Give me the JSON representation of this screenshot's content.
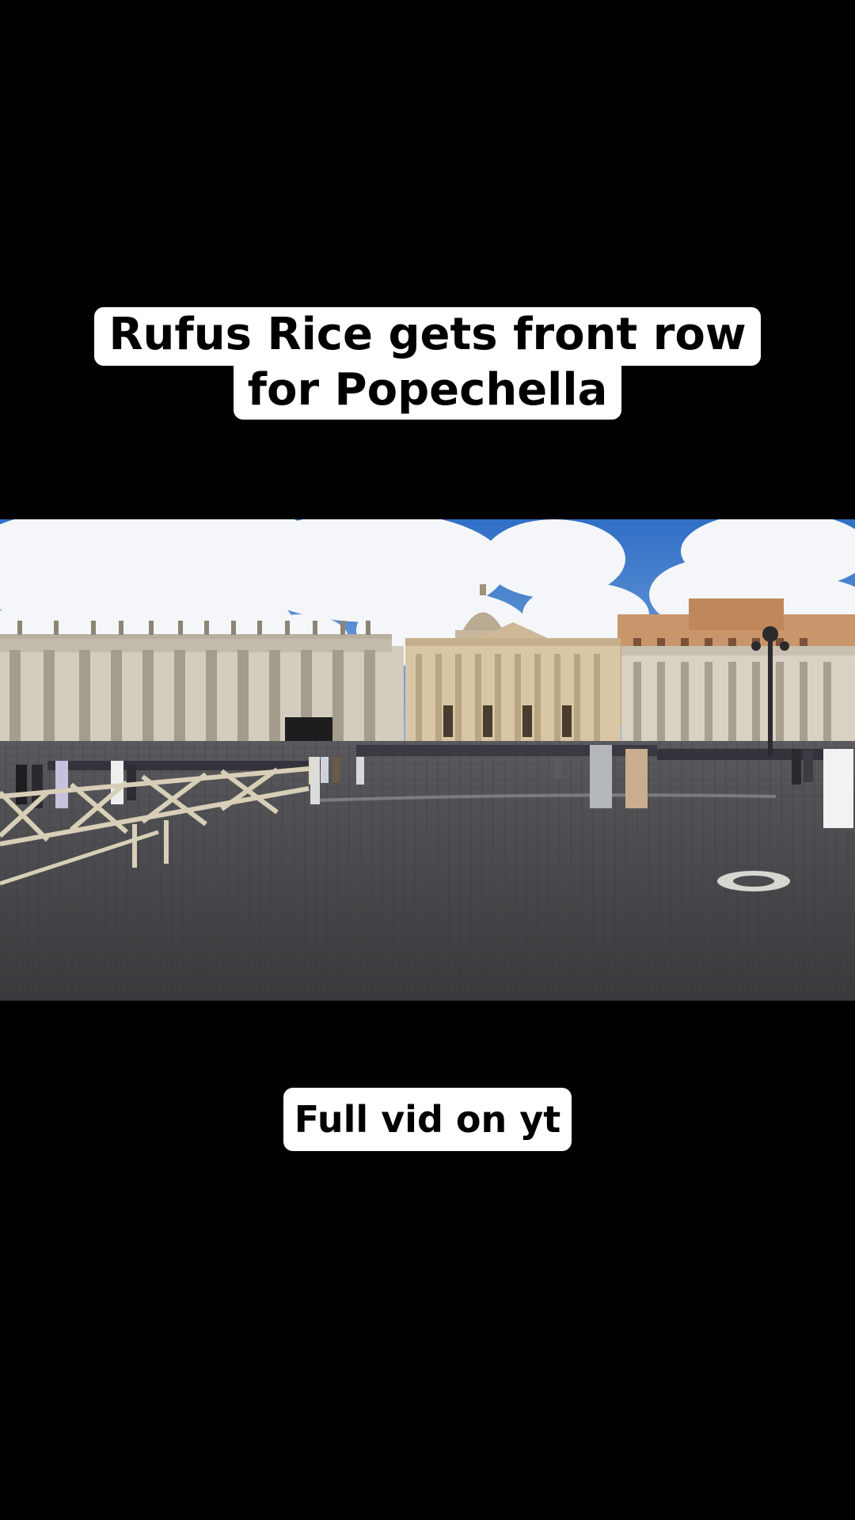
{
  "overlay": {
    "title_line_1": "Rufus Rice gets front row",
    "title_line_2": "for Popechella",
    "footer_text": "Full vid on yt"
  },
  "colors": {
    "background": "#000000",
    "caption_bg": "#ffffff",
    "caption_text": "#000000",
    "sky": "#3f7fd0",
    "basilica_stone": "#d8c6a4",
    "pavement": "#4a4a4e"
  },
  "scene": {
    "photo_subject": "St. Peter's Square with colonnade, basilica and crowd",
    "icons": [
      "colonnade-illustration",
      "basilica-illustration",
      "crowd-illustration",
      "barrier-fence-illustration",
      "lamp-post-illustration",
      "manhole-cover-illustration"
    ]
  }
}
